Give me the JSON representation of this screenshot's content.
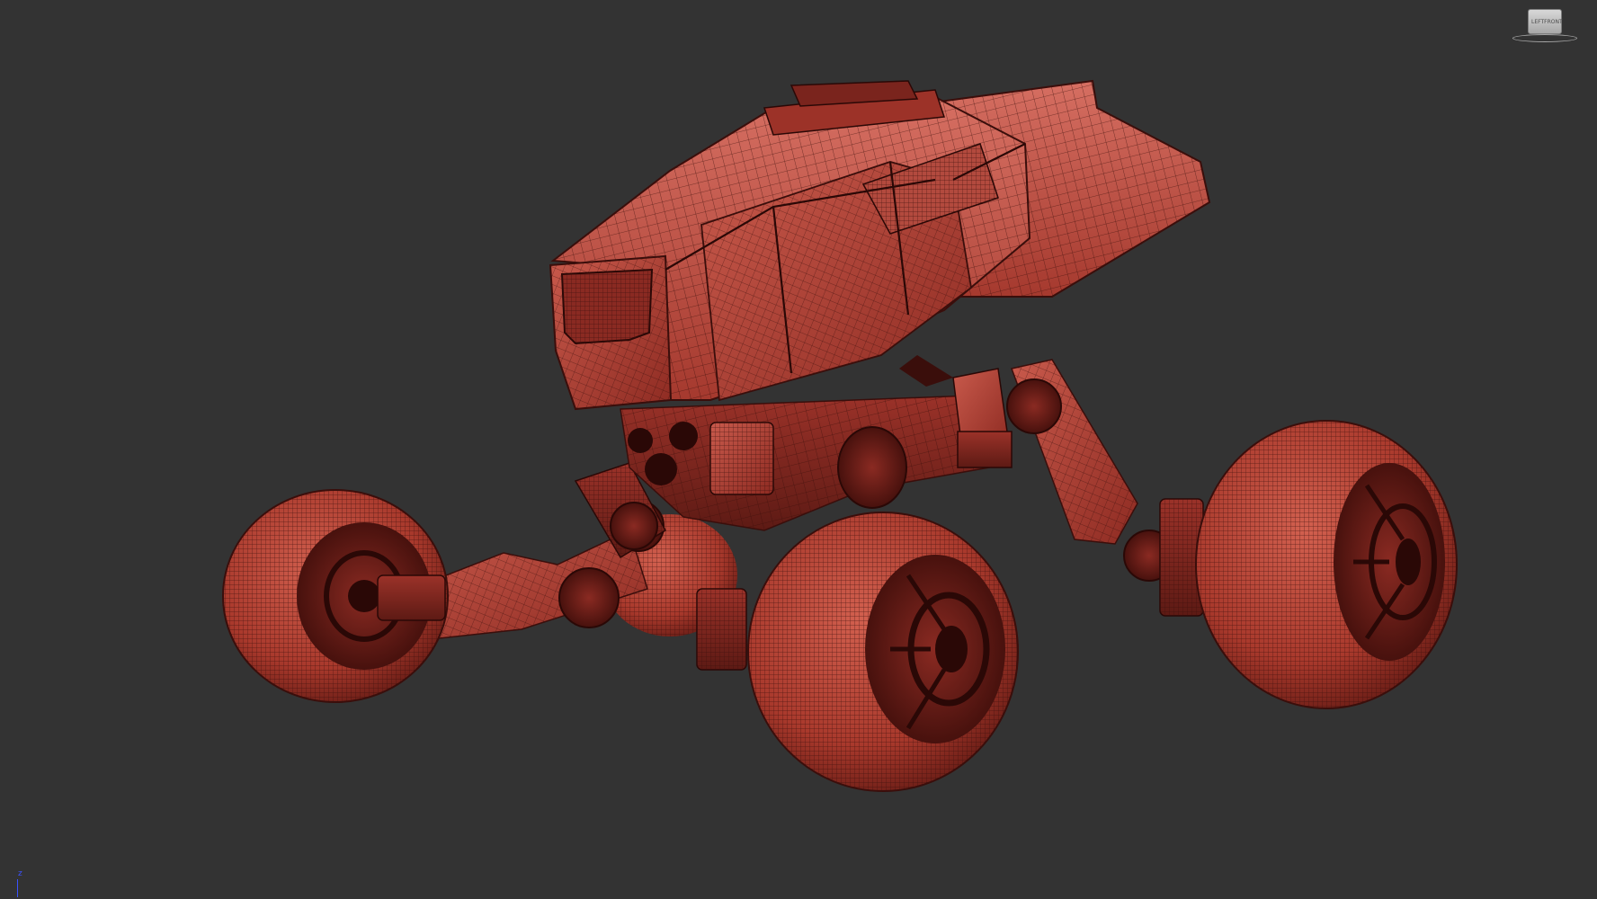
{
  "viewport": {
    "background_color": "#333333",
    "shading_mode": "wireframe-on-shaded",
    "model": {
      "object": "wheeled-rover",
      "wire_color": "#3a0e0b",
      "shade_color": "#b9463c",
      "shade_light": "#d8685c",
      "shade_dark": "#6e1f19"
    }
  },
  "viewcube": {
    "left_label": "LEFT",
    "right_label": "FRONT"
  },
  "axis_gizmo": {
    "z_label": "z",
    "z_color": "#3b52ff"
  }
}
